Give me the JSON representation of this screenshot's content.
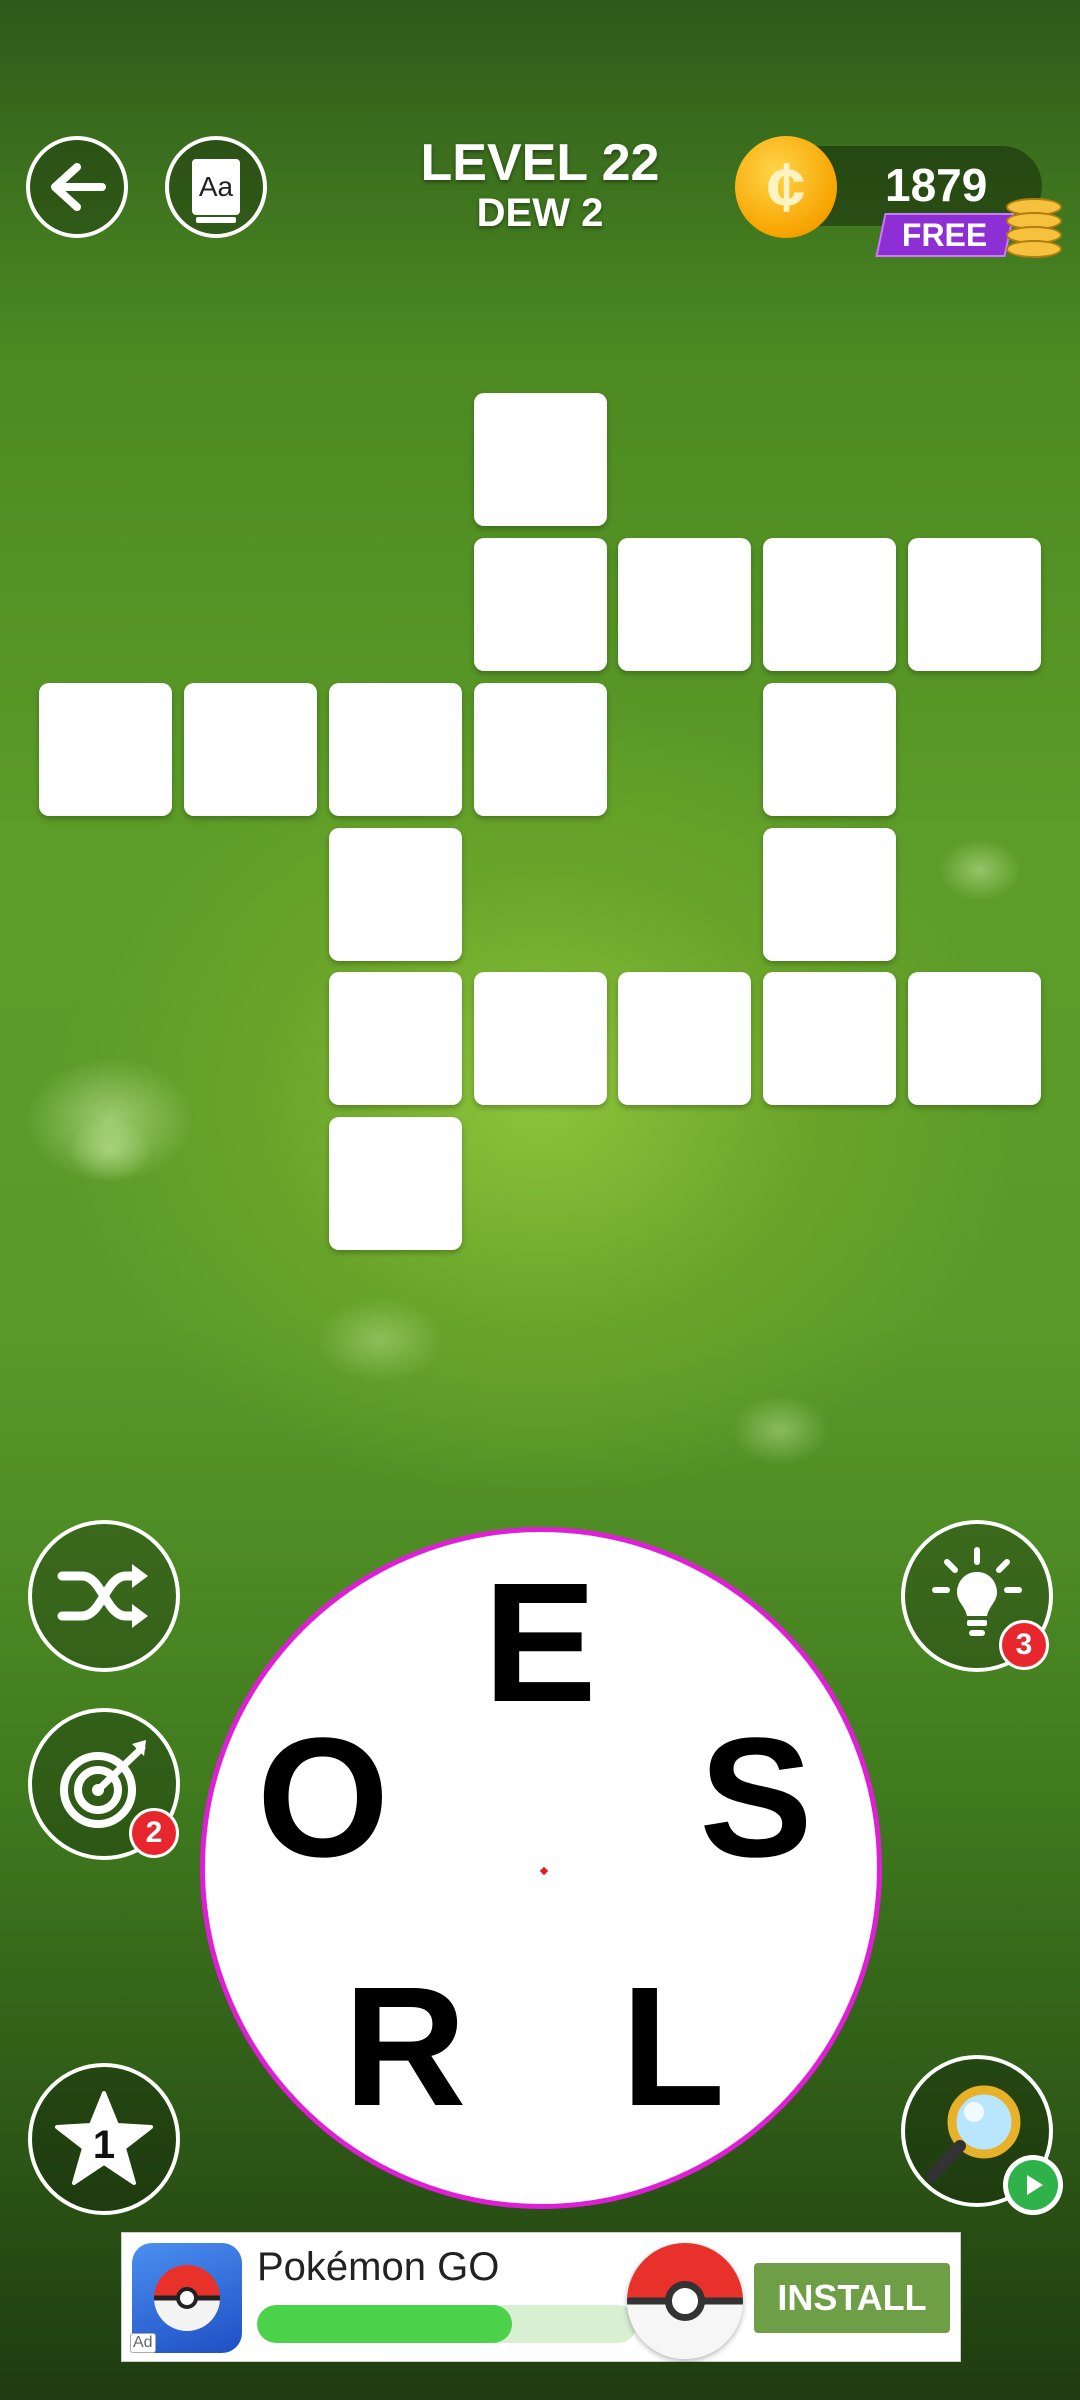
{
  "header": {
    "level_label": "LEVEL 22",
    "sublevel_label": "DEW 2",
    "coins": "1879",
    "free_label": "FREE",
    "coin_symbol": "¢"
  },
  "buttons": {
    "back_icon": "back-arrow-icon",
    "dictionary_label": "Aa",
    "shuffle_icon": "shuffle-icon",
    "target_icon": "target-icon",
    "target_count": "2",
    "star_count": "1",
    "hint_icon": "lightbulb-icon",
    "hint_count": "3",
    "search_icon": "magnifier-icon"
  },
  "wheel": {
    "letters": [
      "E",
      "S",
      "L",
      "R",
      "O"
    ],
    "border_color": "#e01ed8"
  },
  "ad": {
    "title": "Pokémon GO",
    "install_label": "INSTALL",
    "ad_marker": "Ad",
    "progress_percent": 67
  }
}
